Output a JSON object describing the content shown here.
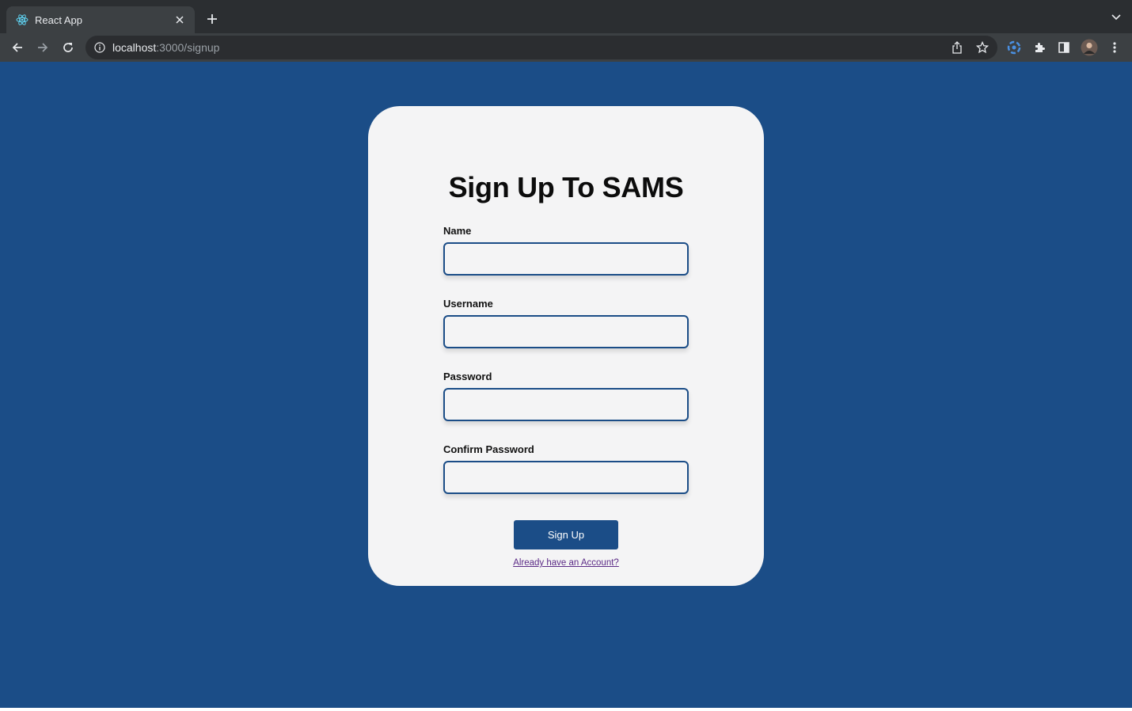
{
  "browser": {
    "tab": {
      "title": "React App",
      "favicon": "react-logo-icon"
    },
    "url": {
      "host": "localhost",
      "path": ":3000/signup"
    },
    "colors": {
      "frame": "#2b2e31",
      "tab_active": "#3c4043",
      "omnibox": "#2b2d30"
    }
  },
  "page": {
    "background": "#1b4d87",
    "card": {
      "title": "Sign Up To SAMS",
      "fields": [
        {
          "label": "Name",
          "value": "",
          "placeholder": ""
        },
        {
          "label": "Username",
          "value": "",
          "placeholder": ""
        },
        {
          "label": "Password",
          "value": "",
          "placeholder": ""
        },
        {
          "label": "Confirm Password",
          "value": "",
          "placeholder": ""
        }
      ],
      "submit_label": "Sign Up",
      "login_link": "Already have an Account?",
      "accent": "#1b4d87",
      "link_color": "#5b2a86"
    }
  }
}
